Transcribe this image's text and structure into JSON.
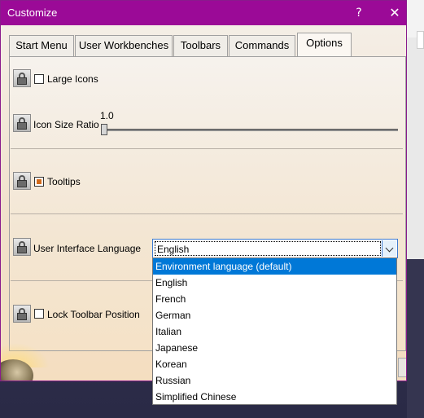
{
  "window": {
    "title": "Customize",
    "help": "?",
    "close": "✕"
  },
  "tabs": [
    {
      "label": "Start Menu"
    },
    {
      "label": "User Workbenches"
    },
    {
      "label": "Toolbars"
    },
    {
      "label": "Commands"
    },
    {
      "label": "Options",
      "active": true
    }
  ],
  "options": {
    "large_icons": {
      "label": "Large Icons",
      "checked": false
    },
    "icon_size_ratio": {
      "label": "Icon Size Ratio",
      "value": "1.0"
    },
    "tooltips": {
      "label": "Tooltips",
      "state": "indeterminate"
    },
    "ui_language": {
      "label": "User Interface Language",
      "selected": "English",
      "options": [
        "Environment language (default)",
        "English",
        "French",
        "German",
        "Italian",
        "Japanese",
        "Korean",
        "Russian",
        "Simplified Chinese"
      ],
      "highlighted": "Environment language (default)"
    },
    "lock_toolbar": {
      "label": "Lock Toolbar Position",
      "checked": false
    }
  },
  "colors": {
    "titlebar": "#9b0a97",
    "selection": "#0078d7",
    "accent_check": "#d26a1a"
  },
  "icons": [
    "lock-icon",
    "help-icon",
    "close-icon",
    "chevron-down-icon"
  ]
}
